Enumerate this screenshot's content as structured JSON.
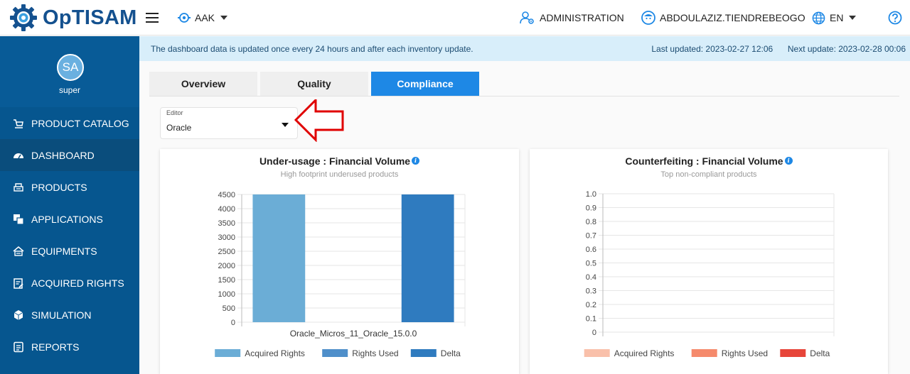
{
  "app": {
    "logo_text": "OpTISAM"
  },
  "topbar": {
    "scope_label": "AAK",
    "admin_label": "ADMINISTRATION",
    "user_label": "ABDOULAZIZ.TIENDREBEOGO",
    "lang_label": "EN"
  },
  "sidebar": {
    "avatar_initials": "SA",
    "user_name": "super",
    "items": [
      {
        "label": "PRODUCT CATALOG",
        "icon": "cart-icon"
      },
      {
        "label": "DASHBOARD",
        "icon": "dashboard-icon"
      },
      {
        "label": "PRODUCTS",
        "icon": "products-icon"
      },
      {
        "label": "APPLICATIONS",
        "icon": "applications-icon"
      },
      {
        "label": "EQUIPMENTS",
        "icon": "equipments-icon"
      },
      {
        "label": "ACQUIRED RIGHTS",
        "icon": "acquired-rights-icon"
      },
      {
        "label": "SIMULATION",
        "icon": "simulation-icon"
      },
      {
        "label": "REPORTS",
        "icon": "reports-icon"
      }
    ]
  },
  "infobar": {
    "message": "The dashboard data is updated once every 24 hours and after each inventory update.",
    "last_updated": "Last updated: 2023-02-27 12:06",
    "next_update": "Next update: 2023-02-28 00:06"
  },
  "tabs": [
    {
      "label": "Overview",
      "active": false
    },
    {
      "label": "Quality",
      "active": false
    },
    {
      "label": "Compliance",
      "active": true
    }
  ],
  "editor": {
    "label": "Editor",
    "value": "Oracle"
  },
  "colors": {
    "primary": "#1e88e5",
    "sidebar": "#06568f",
    "info_bg": "#d8eefa",
    "annotation": "#e00000"
  },
  "chart_data": [
    {
      "type": "bar",
      "title": "Under-usage : Financial Volume",
      "subtitle": "High footprint underused products",
      "categories": [
        "Oracle_Micros_11_Oracle_15.0.0"
      ],
      "series": [
        {
          "name": "Acquired Rights",
          "values": [
            4500
          ],
          "color": "#6badd6"
        },
        {
          "name": "Rights Used",
          "values": [
            0
          ],
          "color": "#4f8fca"
        },
        {
          "name": "Delta",
          "values": [
            4500
          ],
          "color": "#2f7bbf"
        }
      ],
      "yticks": [
        "4500",
        "4000",
        "3500",
        "3000",
        "2500",
        "2000",
        "1500",
        "1000",
        "500",
        "0"
      ],
      "ylim": [
        0,
        4500
      ],
      "grid": true,
      "legend": "bottom"
    },
    {
      "type": "bar",
      "title": "Counterfeiting : Financial Volume",
      "subtitle": "Top non-compliant products",
      "categories": [],
      "series": [
        {
          "name": "Acquired Rights",
          "values": [],
          "color": "#f9c0aa"
        },
        {
          "name": "Rights Used",
          "values": [],
          "color": "#f58a6c"
        },
        {
          "name": "Delta",
          "values": [],
          "color": "#e7453a"
        }
      ],
      "yticks": [
        "1.0",
        "0.9",
        "0.8",
        "0.7",
        "0.6",
        "0.5",
        "0.4",
        "0.3",
        "0.2",
        "0.1",
        "0"
      ],
      "ylim": [
        0,
        1
      ],
      "grid": true,
      "legend": "bottom"
    }
  ]
}
